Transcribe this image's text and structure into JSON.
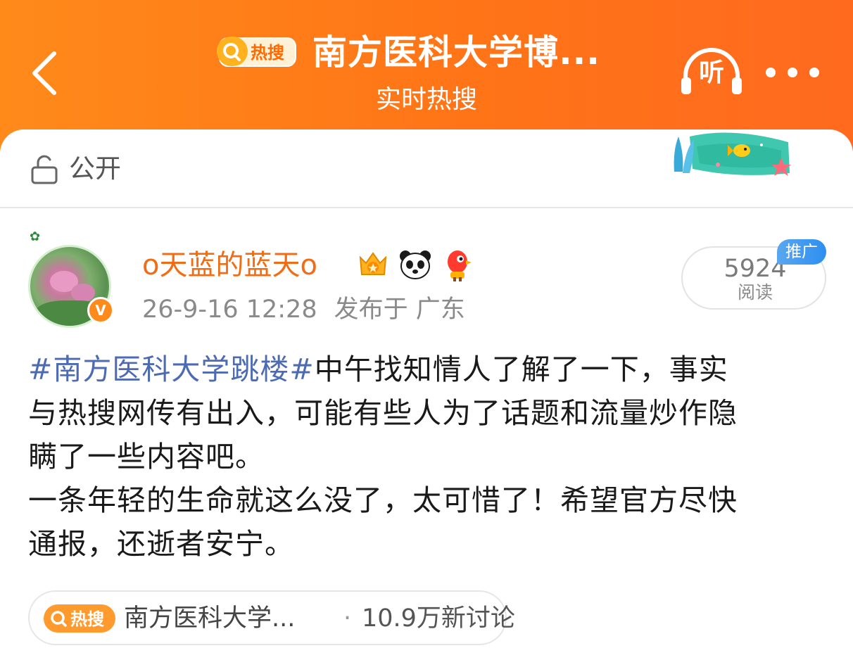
{
  "header": {
    "badge_label": "热搜",
    "title": "南方医科大学博...",
    "subtitle": "实时热搜",
    "listen_label": "听"
  },
  "visibility": {
    "label": "公开"
  },
  "post": {
    "username": "o天蓝的蓝天o",
    "timestamp": "26-9-16 12:28",
    "location": "发布于 广东",
    "read_count": "5924",
    "read_label": "阅读",
    "ad_tag": "推广",
    "hashtag": "#南方医科大学跳楼#",
    "lines": [
      "中午找知情人了解了一下，事实",
      "与热搜网传有出入，可能有些人为了话题和流量炒作隐",
      "瞒了一些内容吧。",
      "一条年轻的生命就这么没了，太可惜了！希望官方尽快",
      "通报，还逝者安宁。"
    ]
  },
  "hot_topic": {
    "badge_label": "热搜",
    "title": "南方医科大学...",
    "dot": "·",
    "discussion": "10.9万新讨论"
  },
  "colors": {
    "header_orange": "#ff7a18",
    "username_orange": "#f06d15",
    "hashtag_blue": "#4d6bb3",
    "ad_blue": "#2d8ff0"
  }
}
